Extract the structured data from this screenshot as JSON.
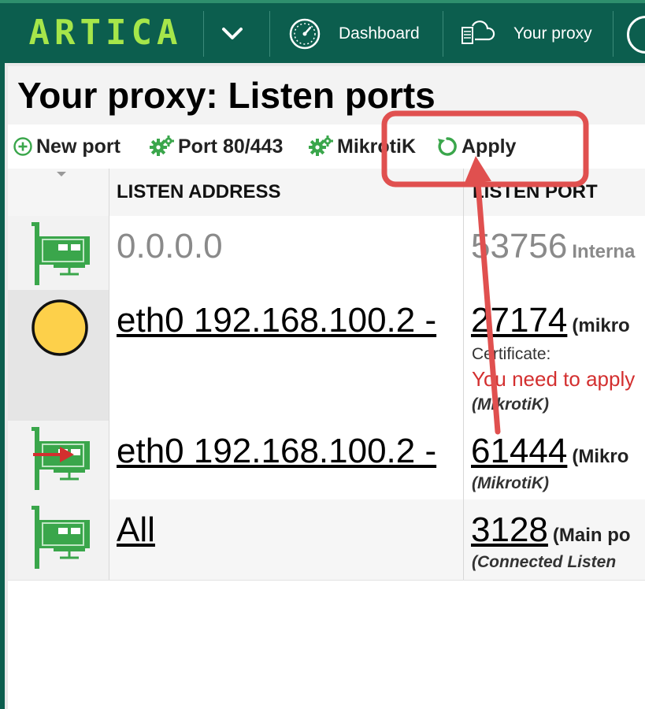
{
  "nav": {
    "logo": "ARTICA",
    "dashboard_label": "Dashboard",
    "proxy_label": "Your proxy"
  },
  "page": {
    "title": "Your proxy: Listen ports"
  },
  "toolbar": {
    "new_port": "New port",
    "port_80_443": "Port 80/443",
    "mikrotik": "MikrotiK",
    "apply": "Apply"
  },
  "table": {
    "columns": [
      "LISTEN ADDRESS",
      "LISTEN PORT"
    ],
    "rows": [
      {
        "address": "0.0.0.0",
        "port": "53756",
        "port_label": "Interna",
        "certificate": "",
        "warning": "",
        "tag": ""
      },
      {
        "address": "eth0 192.168.100.2 -",
        "port": "27174",
        "port_label": "(mikro",
        "certificate": "Certificate:",
        "warning": "You need to apply",
        "tag": "(MikrotiK)"
      },
      {
        "address": "eth0 192.168.100.2 -",
        "port": "61444",
        "port_label": "(Mikro",
        "certificate": "",
        "warning": "",
        "tag": "(MikrotiK)"
      },
      {
        "address": "All",
        "port": "3128",
        "port_label": "(Main po",
        "certificate": "",
        "warning": "",
        "tag": "(Connected Listen"
      }
    ]
  },
  "colors": {
    "nav_bg": "#0c5e4e",
    "logo": "#a6e64a",
    "icon_green": "#3aa64b",
    "warning_red": "#d32f2f",
    "annotation": "#e0504f",
    "status_yellow": "#fdd04a"
  },
  "icons": [
    "chevron-down-icon",
    "dashboard-gauge-icon",
    "proxy-cloud-icon",
    "add-circle-icon",
    "gear-icon",
    "refresh-icon",
    "network-card-icon",
    "yellow-circle-icon",
    "red-arrow-icon"
  ]
}
